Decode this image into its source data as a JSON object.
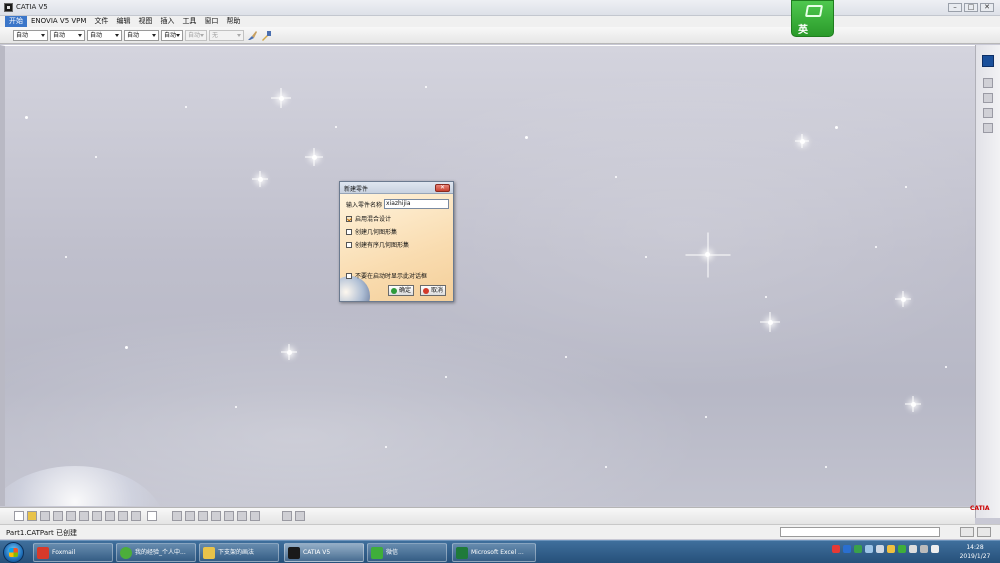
{
  "window": {
    "title": "CATIA V5",
    "controls": [
      "–",
      "□",
      "✕"
    ]
  },
  "badge": {
    "char": "英"
  },
  "menu": {
    "items": [
      "开始",
      "ENOVIA V5 VPM",
      "文件",
      "编辑",
      "视图",
      "插入",
      "工具",
      "窗口",
      "帮助"
    ]
  },
  "toolbar": {
    "selects": [
      {
        "value": "自动",
        "disabled": false
      },
      {
        "value": "自动",
        "disabled": false
      },
      {
        "value": "自动",
        "disabled": false
      },
      {
        "value": "自动",
        "disabled": false
      },
      {
        "value": "自动",
        "disabled": false
      },
      {
        "value": "自动",
        "disabled": true
      },
      {
        "value": "无",
        "disabled": true
      }
    ],
    "icons": [
      "paint-brush-icon",
      "format-painter-icon"
    ]
  },
  "dialog": {
    "title": "新建零件",
    "close": "✕",
    "name_label": "输入零件名称",
    "name_value": "xiazhijia",
    "checkboxes": [
      {
        "label": "启用混合设计",
        "checked": true
      },
      {
        "label": "创建几何图形集",
        "checked": false
      },
      {
        "label": "创建有序几何图形集",
        "checked": false
      },
      {
        "label": "不要在启动时显示此对话框",
        "checked": false
      }
    ],
    "ok_label": "确定",
    "cancel_label": "取消"
  },
  "status": {
    "message": "Part1.CATPart 已创建"
  },
  "catia_logo": "CATIA",
  "taskbar": {
    "tasks": [
      {
        "label": "Foxmail",
        "color": "#d83a2a"
      },
      {
        "label": "我的经验_个人中...",
        "color": "#4cae3a"
      },
      {
        "label": "下支架的画法",
        "color": "#e8c34a"
      },
      {
        "label": "CATIA V5",
        "color": "#1a1a1a"
      },
      {
        "label": "微信",
        "color": "#3fae3a"
      },
      {
        "label": "Microsoft Excel ...",
        "color": "#1f7a3a"
      }
    ],
    "clock_time": "14:28",
    "clock_date": "2019/1/27",
    "colors": {
      "accent": "#3b76c9",
      "taskbar": "#26507a",
      "dialog_bg": "#fbe5c6"
    }
  }
}
